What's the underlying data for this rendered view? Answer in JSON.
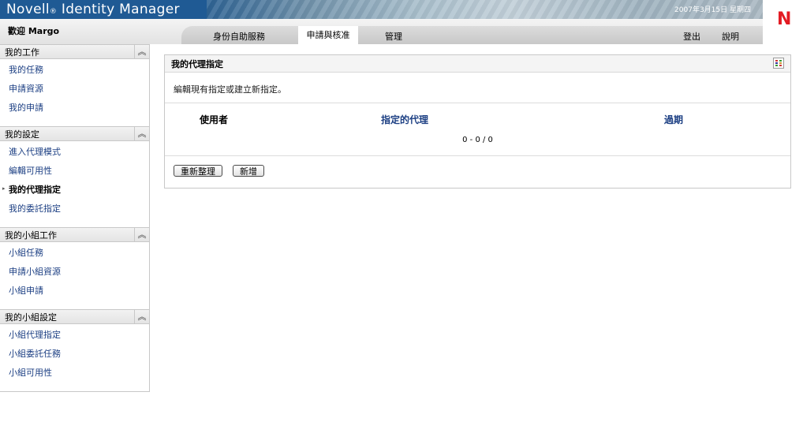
{
  "header": {
    "brand": "Novell",
    "brand_reg": "®",
    "brand_product": " Identity Manager",
    "date": "2007年3月15日 星期四",
    "logo_letter": "N",
    "welcome": "歡迎 Margo",
    "tabs": [
      {
        "label": "身份自助服務",
        "active": false
      },
      {
        "label": "申請與核准",
        "active": true
      },
      {
        "label": "管理",
        "active": false
      }
    ],
    "logout": "登出",
    "help": "說明"
  },
  "sidebar": {
    "collapse_icon": "double-chevron-up-icon",
    "sections": [
      {
        "title": "我的工作",
        "items": [
          "我的任務",
          "申請資源",
          "我的申請"
        ]
      },
      {
        "title": "我的設定",
        "items": [
          "進入代理模式",
          "編輯可用性",
          "我的代理指定",
          "我的委託指定"
        ],
        "active_index": 2
      },
      {
        "title": "我的小組工作",
        "items": [
          "小組任務",
          "申請小組資源",
          "小組申請"
        ]
      },
      {
        "title": "我的小組設定",
        "items": [
          "小組代理指定",
          "小組委託任務",
          "小組可用性"
        ]
      }
    ]
  },
  "panel": {
    "title": "我的代理指定",
    "instructions": "編輯現有指定或建立新指定。",
    "columns": [
      "使用者",
      "指定的代理",
      "過期"
    ],
    "pager": "0 - 0 / 0",
    "buttons": {
      "refresh": "重新整理",
      "new": "新增"
    }
  },
  "colors": {
    "brand_blue": "#1f5a94",
    "link_blue": "#1c3f83",
    "logo_red": "#e31b23"
  }
}
